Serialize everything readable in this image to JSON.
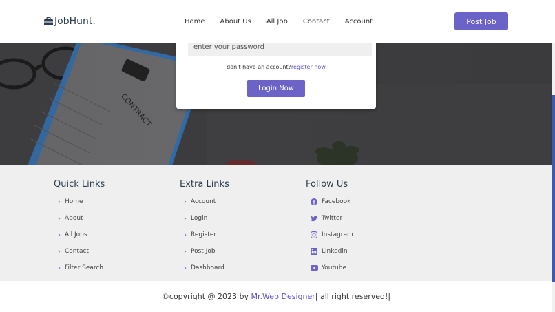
{
  "header": {
    "logo_text": "JobHunt.",
    "nav": [
      "Home",
      "About Us",
      "All Job",
      "Contact",
      "Account"
    ],
    "post_job_label": "Post Job"
  },
  "login": {
    "password_placeholder": "enter your password",
    "register_prompt": "don't have an account?",
    "register_link": "register now",
    "login_button": "Login Now"
  },
  "footer": {
    "quick_links": {
      "title": "Quick Links",
      "items": [
        "Home",
        "About",
        "All Jobs",
        "Contact",
        "Filter Search"
      ]
    },
    "extra_links": {
      "title": "Extra Links",
      "items": [
        "Account",
        "Login",
        "Register",
        "Post Job",
        "Dashboard"
      ]
    },
    "follow_us": {
      "title": "Follow Us",
      "items": [
        {
          "label": "Facebook",
          "icon": "facebook-icon"
        },
        {
          "label": "Twitter",
          "icon": "twitter-icon"
        },
        {
          "label": "Instagram",
          "icon": "instagram-icon"
        },
        {
          "label": "Linkedin",
          "icon": "linkedin-icon"
        },
        {
          "label": "Youtube",
          "icon": "youtube-icon"
        }
      ]
    },
    "copyright_prefix": "©copyright @ 2023 by ",
    "copyright_brand": "Mr.Web Designer",
    "copyright_suffix": "| all right reserved!|"
  },
  "colors": {
    "accent": "#6c63c9",
    "footer_bg": "#efefef",
    "hero_bg": "#3a3a3c"
  }
}
